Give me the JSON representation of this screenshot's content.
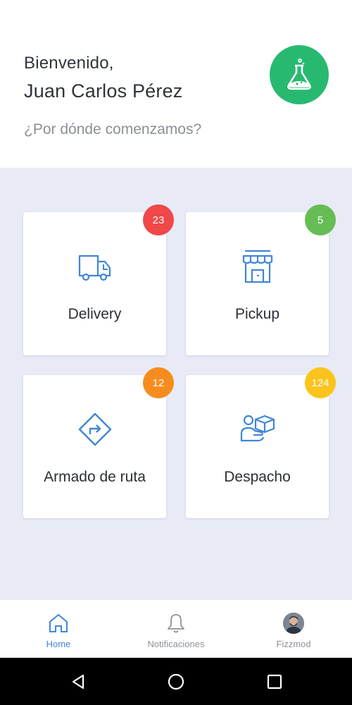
{
  "header": {
    "greeting": "Bienvenido,",
    "user_name": "Juan Carlos Pérez",
    "question": "¿Por dónde comenzamos?",
    "logo_icon": "flask-icon"
  },
  "cards": [
    {
      "label": "Delivery",
      "badge": "23",
      "badge_color": "#f04848",
      "icon": "truck-icon"
    },
    {
      "label": "Pickup",
      "badge": "5",
      "badge_color": "#66bd55",
      "icon": "store-icon"
    },
    {
      "label": "Armado de ruta",
      "badge": "12",
      "badge_color": "#f78c1e",
      "icon": "route-sign-icon"
    },
    {
      "label": "Despacho",
      "badge": "124",
      "badge_color": "#fbc41d",
      "icon": "hand-box-icon"
    }
  ],
  "bottom_nav": {
    "items": [
      {
        "label": "Home",
        "icon": "home-icon",
        "active": true
      },
      {
        "label": "Notificaciones",
        "icon": "bell-icon",
        "active": false
      },
      {
        "label": "Fizzmod",
        "icon": "avatar",
        "active": false
      }
    ]
  },
  "colors": {
    "accent": "#3f86d6",
    "logo_green": "#28b971",
    "content_bg": "#e8ebf6"
  }
}
